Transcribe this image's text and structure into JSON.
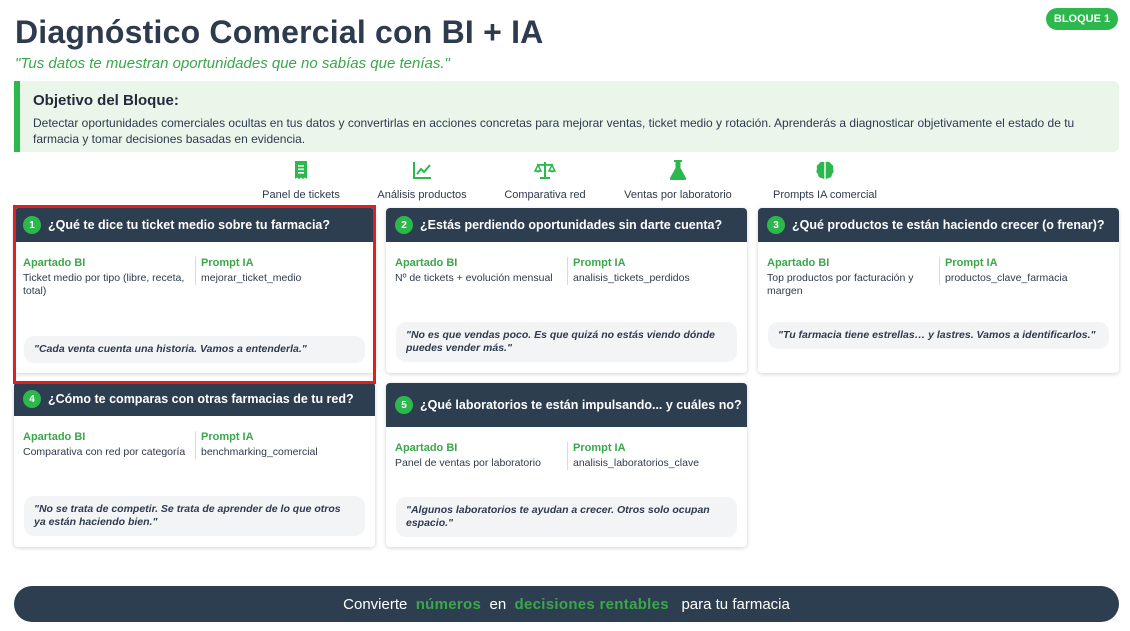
{
  "header": {
    "title": "Diagnóstico Comercial con BI + IA",
    "subtitle": "\"Tus datos te muestran oportunidades que no sabías que tenías.\"",
    "badge": "BLOQUE 1"
  },
  "objective": {
    "title": "Objetivo del Bloque:",
    "text": "Detectar oportunidades comerciales ocultas en tus datos y convertirlas en acciones concretas para mejorar ventas, ticket medio y rotación. Aprenderás a diagnosticar objetivamente el estado de tu farmacia y tomar decisiones basadas en evidencia."
  },
  "nav": [
    {
      "label": "Panel de tickets",
      "icon": "receipt-icon"
    },
    {
      "label": "Análisis productos",
      "icon": "line-chart-icon"
    },
    {
      "label": "Comparativa red",
      "icon": "balance-scale-icon"
    },
    {
      "label": "Ventas por laboratorio",
      "icon": "flask-icon"
    },
    {
      "label": "Prompts IA comercial",
      "icon": "brain-icon"
    }
  ],
  "labels": {
    "bi": "Apartado BI",
    "ia": "Prompt IA"
  },
  "cards": [
    {
      "number": "1",
      "title": "¿Qué te dice tu ticket medio sobre tu farmacia?",
      "bi": "Ticket medio por tipo (libre, receta, total)",
      "ia": "mejorar_ticket_medio",
      "quote": "\"Cada venta cuenta una historia. Vamos a entenderla.\""
    },
    {
      "number": "2",
      "title": "¿Estás perdiendo oportunidades sin darte cuenta?",
      "bi": "Nº de tickets + evolución mensual",
      "ia": "analisis_tickets_perdidos",
      "quote": "\"No es que vendas poco. Es que quizá no estás viendo dónde puedes vender más.\""
    },
    {
      "number": "3",
      "title": "¿Qué productos te están haciendo crecer (o frenar)?",
      "bi": "Top productos por facturación y margen",
      "ia": "productos_clave_farmacia",
      "quote": "\"Tu farmacia tiene estrellas… y lastres. Vamos a identificarlos.\""
    },
    {
      "number": "4",
      "title": "¿Cómo te comparas con otras farmacias de tu red?",
      "bi": "Comparativa con red por categoría",
      "ia": "benchmarking_comercial",
      "quote": "\"No se trata de competir. Se trata de aprender de lo que otros ya están haciendo bien.\""
    },
    {
      "number": "5",
      "title": "¿Qué laboratorios te están impulsando... y cuáles no?",
      "bi": "Panel de ventas por laboratorio",
      "ia": "analisis_laboratorios_clave",
      "quote": "\"Algunos laboratorios te ayudan a crecer. Otros solo ocupan espacio.\""
    }
  ],
  "footer": {
    "part1": "Convierte",
    "green1": "números",
    "part2": "en",
    "green2": "decisiones rentables",
    "part3": "para tu farmacia"
  },
  "colors": {
    "accent": "#2db84d",
    "dark": "#2c3e50",
    "highlight": "#e02020"
  }
}
